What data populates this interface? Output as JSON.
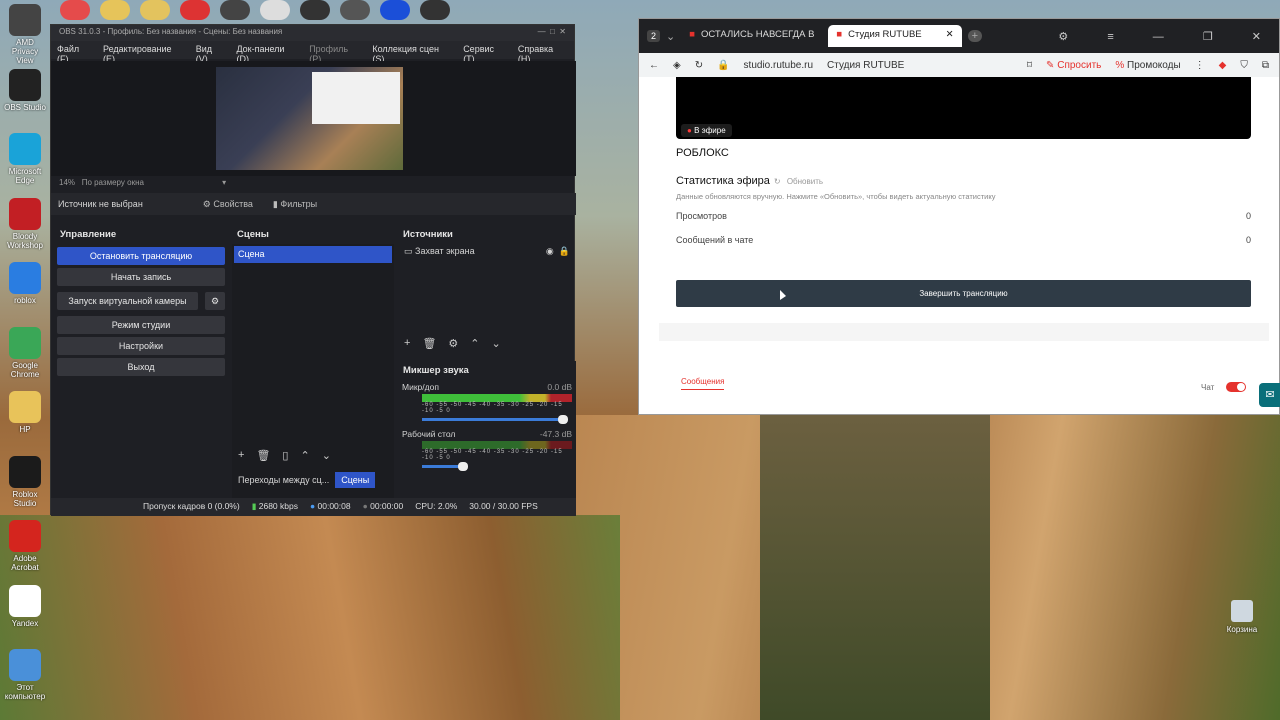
{
  "desktop": {
    "icons": [
      {
        "label": "AMD Privacy View",
        "color": "#444"
      },
      {
        "label": "OBS Studio",
        "color": "#222"
      },
      {
        "label": "Microsoft Edge",
        "color": "#1aa3d8"
      },
      {
        "label": "Bloody Workshop",
        "color": "#c21f24"
      },
      {
        "label": "roblox",
        "color": "#2a7de1"
      },
      {
        "label": "Google Chrome",
        "color": "#3aa757"
      },
      {
        "label": "HP",
        "color": "#e8c35a"
      },
      {
        "label": "Roblox Studio",
        "color": "#1b1b1b"
      },
      {
        "label": "Adobe Acrobat",
        "color": "#d4251e"
      },
      {
        "label": "Yandex",
        "color": "#fff"
      },
      {
        "label": "Этот компьютер",
        "color": "#4a90d9"
      }
    ],
    "trash": "Корзина"
  },
  "obs": {
    "title": "OBS 31.0.3 - Профиль: Без названия - Сцены: Без названия",
    "menu": [
      "Файл (F)",
      "Редактирование (E)",
      "Вид (V)",
      "Док-панели (D)",
      "Профиль (P)",
      "Коллекция сцен (S)",
      "Сервис (T)",
      "Справка (H)"
    ],
    "zoom": "14%",
    "zoom_mode": "По размеру окна",
    "no_source": "Источник не выбран",
    "properties": "Свойства",
    "filters": "Фильтры",
    "controls": {
      "title": "Управление",
      "buttons": [
        "Остановить трансляцию",
        "Начать запись",
        "Запуск виртуальной камеры",
        "Режим студии",
        "Настройки",
        "Выход"
      ]
    },
    "scenes": {
      "title": "Сцены",
      "items": [
        "Сцена"
      ]
    },
    "sources": {
      "title": "Источники",
      "items": [
        "Захват экрана"
      ]
    },
    "mixer": {
      "title": "Микшер звука",
      "channels": [
        {
          "name": "Микр/доп",
          "db": "0.0 dB",
          "level": 0.78
        },
        {
          "name": "Рабочий стол",
          "db": "-47.3 dB",
          "level": 0.1
        }
      ],
      "ticks": "-60 -55 -50 -45 -40 -35 -30 -25 -20 -15 -10 -5 0"
    },
    "transitions": "Переходы между сц...",
    "scenes_tab": "Сцены",
    "status": {
      "dropped": "Пропуск кадров 0 (0.0%)",
      "bitrate": "2680 kbps",
      "stream_time": "00:00:08",
      "rec_time": "00:00:00",
      "cpu": "CPU: 2.0%",
      "fps": "30.00 / 30.00 FPS"
    }
  },
  "browser": {
    "tab_count": "2",
    "tabs": [
      {
        "label": "ОСТАЛИСЬ НАВСЕГДА В"
      },
      {
        "label": "Студия RUTUBE"
      }
    ],
    "url": "studio.rutube.ru",
    "page_title": "Студия RUTUBE",
    "ask": "Спросить",
    "promo": "Промокоды",
    "live_badge": "В эфире",
    "channel": "РОБЛОКС",
    "stats_title": "Статистика эфира",
    "refresh": "Обновить",
    "note": "Данные обновляются вручную. Нажмите «Обновить», чтобы видеть актуальную статистику",
    "views_label": "Просмотров",
    "views": "0",
    "msgs_label": "Сообщений в чате",
    "msgs": "0",
    "end_button": "Завершить трансляцию",
    "messages_tab": "Сообщения",
    "chat_label": "Чат"
  }
}
